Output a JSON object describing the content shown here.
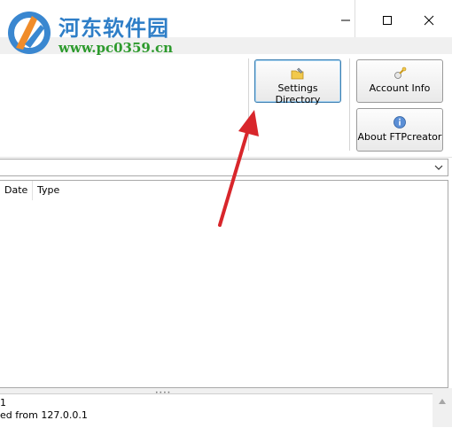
{
  "watermark": {
    "site_name": "河东软件园",
    "site_url": "www.pc0359.cn"
  },
  "window_controls": {
    "minimize": "—",
    "maximize": "☐",
    "close": "✕"
  },
  "toolbar": {
    "settings_directory": "Settings Directory",
    "account_info": "Account Info",
    "about": "About FTPcreator"
  },
  "file_list": {
    "columns": [
      "Date",
      "Type"
    ]
  },
  "log": {
    "lines": [
      "1",
      "ed from 127.0.0.1"
    ]
  },
  "colors": {
    "annotation_arrow": "#d8262b",
    "focus_border": "#3c7fb1",
    "watermark_blue": "#2e7ec7",
    "watermark_green": "#2d9a2d"
  }
}
